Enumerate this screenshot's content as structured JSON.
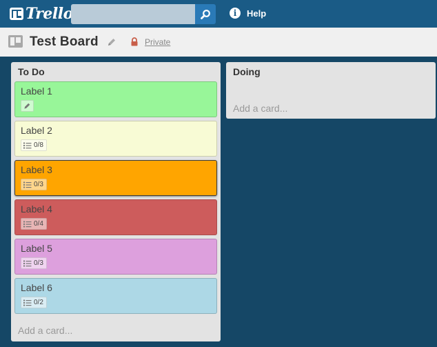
{
  "header": {
    "logo_text": "Trello",
    "search": {
      "value": "",
      "placeholder": ""
    },
    "help_label": "Help",
    "icons": {
      "logo": "trello-logo-icon",
      "search": "search-icon",
      "info": "info-icon"
    }
  },
  "board": {
    "title": "Test Board",
    "privacy": "Private",
    "icons": {
      "board": "board-icon",
      "edit": "pencil-icon",
      "privacy": "lock-icon"
    },
    "colors": {
      "privacy_lock": "#c85f4a"
    }
  },
  "lists": [
    {
      "name": "To Do",
      "add_card": "Add a card...",
      "cards": [
        {
          "label": "Label 1",
          "color": "#98f699",
          "badge_type": "edit"
        },
        {
          "label": "Label 2",
          "color": "#f8fbd5",
          "badge_type": "checklist",
          "checklist": "0/8"
        },
        {
          "label": "Label 3",
          "color": "#ffa500",
          "badge_type": "checklist",
          "checklist": "0/3",
          "selected": true
        },
        {
          "label": "Label 4",
          "color": "#cd5c5c",
          "badge_type": "checklist",
          "checklist": "0/4"
        },
        {
          "label": "Label 5",
          "color": "#dda0dd",
          "badge_type": "checklist",
          "checklist": "0/3"
        },
        {
          "label": "Label 6",
          "color": "#add8e6",
          "badge_type": "checklist",
          "checklist": "0/2"
        }
      ]
    },
    {
      "name": "Doing",
      "add_card": "Add a card...",
      "cards": []
    }
  ],
  "colors": {
    "topbar": "#1a5b86",
    "board_background": "#154766",
    "list_background": "#e3e3e3",
    "search_button": "#2a7ab7"
  }
}
